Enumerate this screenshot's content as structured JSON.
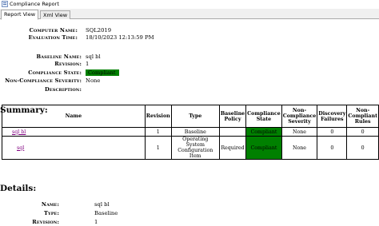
{
  "window": {
    "title": "Compliance Report"
  },
  "tabs": [
    {
      "label": "Report View",
      "active": true
    },
    {
      "label": "Xml View",
      "active": false
    }
  ],
  "header_info": {
    "computer_name_label": "Computer Name:",
    "computer_name": "SQL2019",
    "evaluation_time_label": "Evaluation Time:",
    "evaluation_time": "18/10/2023 12:13:59 PM",
    "baseline_name_label": "Baseline Name:",
    "baseline_name": "sql bl",
    "revision_label": "Revision:",
    "revision": "1",
    "compliance_state_label": "Compliance State:",
    "compliance_state": "Compliant",
    "non_compliance_severity_label": "Non-Compliance Severity:",
    "non_compliance_severity": "None",
    "description_label": "Description:",
    "description": ""
  },
  "summary": {
    "heading": "Summary:",
    "columns": [
      "Name",
      "Revision",
      "Type",
      "Baseline Policy",
      "Compliance State",
      "Non-Compliance Severity",
      "Discovery Failures",
      "Non-Compliant Rules"
    ],
    "rows": [
      {
        "name": "sql bl",
        "revision": "1",
        "type": "Baseline",
        "baseline_policy": "",
        "compliance_state": "Compliant",
        "severity": "None",
        "discovery_failures": "0",
        "non_compliant_rules": "0"
      },
      {
        "name": "sql",
        "revision": "1",
        "type": "Operating System Configuration Item",
        "baseline_policy": "Required",
        "compliance_state": "Compliant",
        "severity": "None",
        "discovery_failures": "0",
        "non_compliant_rules": "0"
      }
    ]
  },
  "details": {
    "heading": "Details:",
    "name_label": "Name:",
    "name": "sql bl",
    "type_label": "Type:",
    "type": "Baseline",
    "revision_label": "Revision:",
    "revision": "1"
  },
  "colors": {
    "compliant_green": "#008000",
    "link_purple": "#800080",
    "tabstrip_bg": "#f0f0f0"
  }
}
